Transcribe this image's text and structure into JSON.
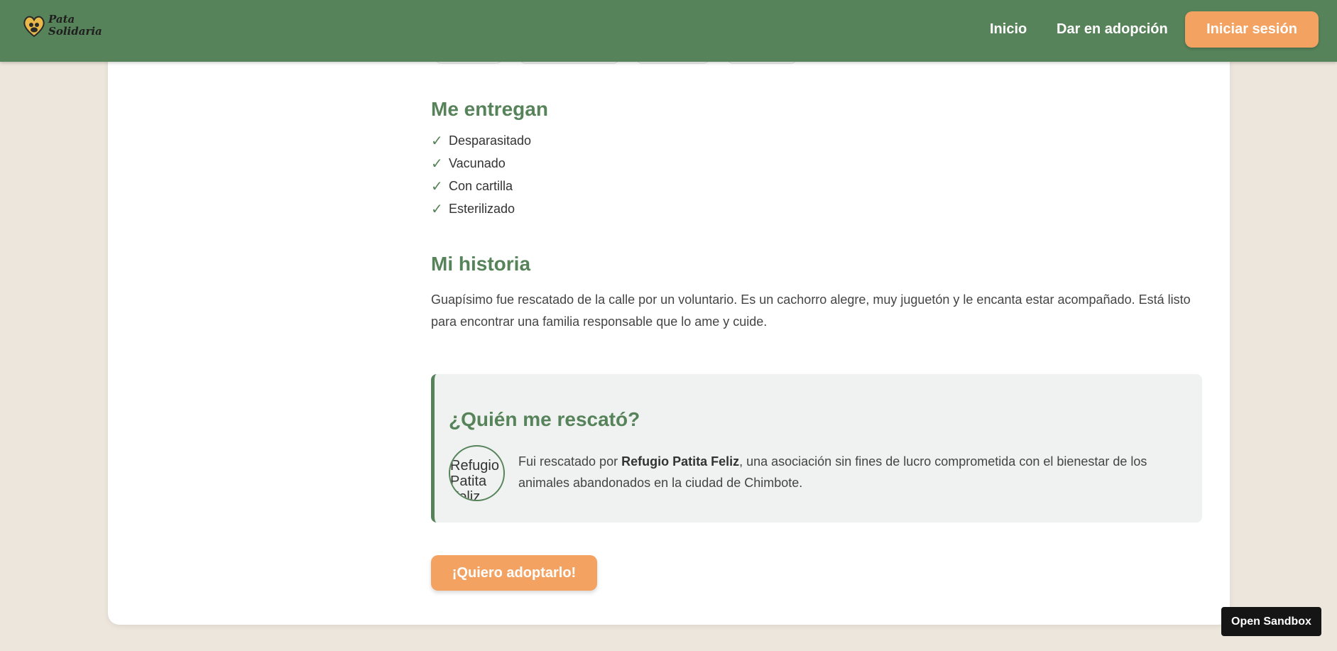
{
  "header": {
    "logo_line1": "Pata",
    "logo_line2": "Solidaria",
    "nav_inicio": "Inicio",
    "nav_dar_adopcion": "Dar en adopción",
    "login_label": "Iniciar sesión"
  },
  "details": {
    "entregan_title": "Me entregan",
    "entregan_items": [
      "Desparasitado",
      "Vacunado",
      "Con cartilla",
      "Esterilizado"
    ],
    "check_symbol": "✓",
    "historia_title": "Mi historia",
    "historia_text": "Guapísimo fue rescatado de la calle por un voluntario. Es un cachorro alegre, muy juguetón y le encanta estar acompañado. Está listo para encontrar una familia responsable que lo ame y cuide."
  },
  "rescuer": {
    "title": "¿Quién me rescató?",
    "image_alt": "Refugio Patita Feliz",
    "text_before": "Fui rescatado por ",
    "name": "Refugio Patita Feliz",
    "text_after": ", una asociación sin fines de lucro comprometida con el bienestar de los animales abandonados en la ciudad de Chimbote."
  },
  "actions": {
    "adopt_label": "¡Quiero adoptarlo!",
    "sandbox_label": "Open Sandbox"
  },
  "colors": {
    "primary_green": "#57835a",
    "accent_orange": "#f4a261",
    "page_bg": "#ede6dc",
    "rescuer_bg": "#eff2f0"
  }
}
